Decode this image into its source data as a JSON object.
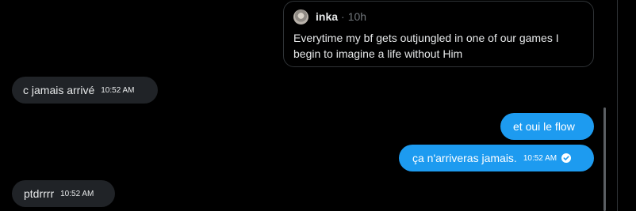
{
  "quote": {
    "author": "inka",
    "separator": "·",
    "time": "10h",
    "text": "Everytime my bf gets outjungled in one of our games I begin to imagine a life without Him"
  },
  "messages": [
    {
      "direction": "incoming",
      "text": "c jamais arrivé",
      "time": "10:52 AM"
    },
    {
      "direction": "outgoing",
      "text": "et oui le flow",
      "time": ""
    },
    {
      "direction": "outgoing",
      "text": "ça n'arriveras jamais.",
      "time": "10:52 AM",
      "status_icon": "read-check-icon"
    },
    {
      "direction": "incoming",
      "text": "ptdrrrr",
      "time": "10:52 AM"
    }
  ],
  "colors": {
    "background": "#000000",
    "incoming_bubble": "#202327",
    "outgoing_bubble": "#1d9bf0",
    "border": "#2f3336",
    "muted_text": "#71767b"
  }
}
